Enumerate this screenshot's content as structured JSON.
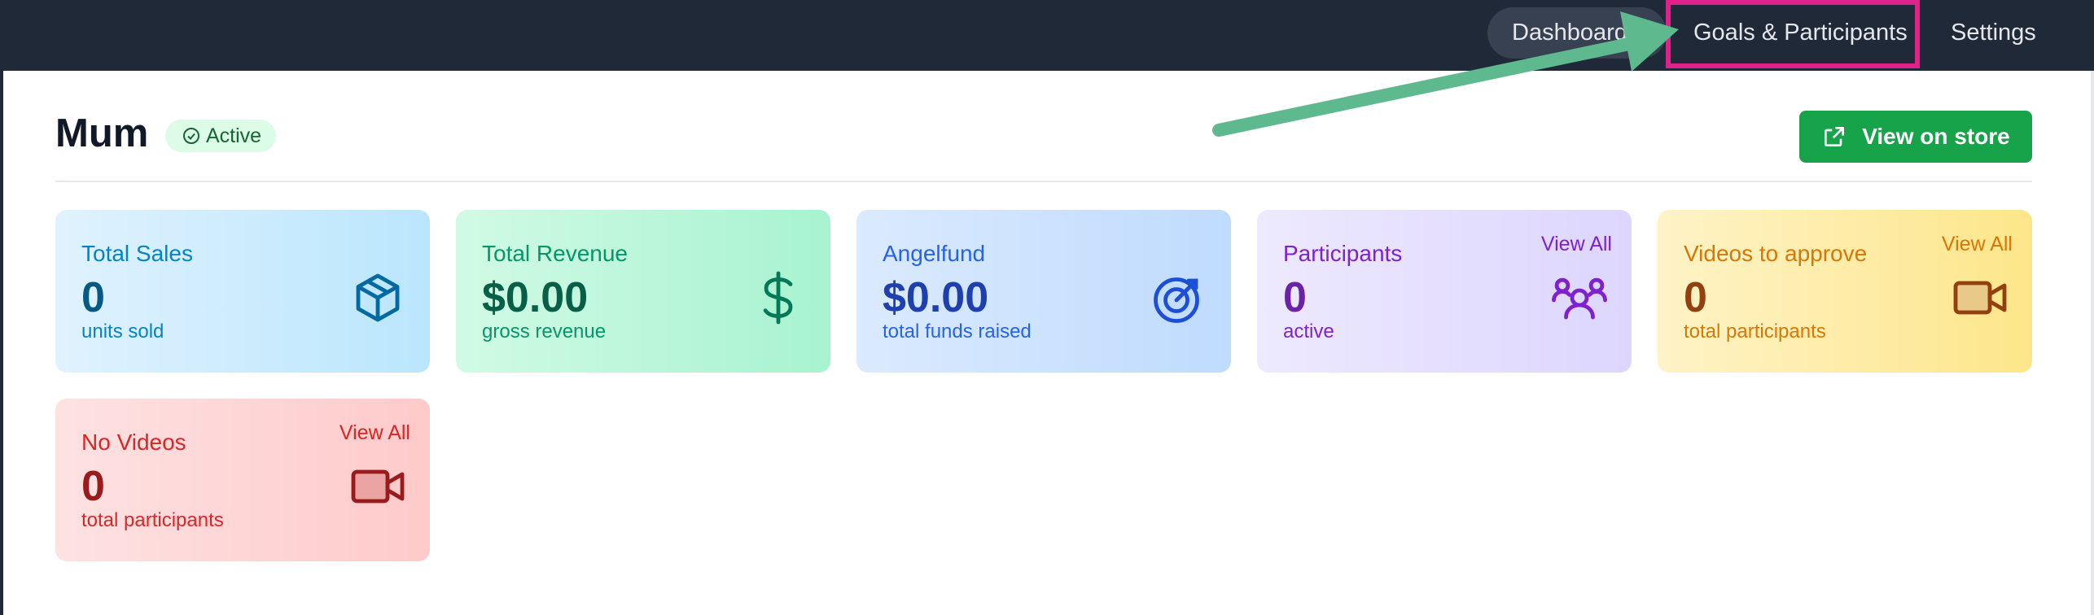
{
  "nav": {
    "dashboard_label": "Dashboard",
    "goals_label": "Goals & Participants",
    "settings_label": "Settings"
  },
  "header": {
    "title": "Mum",
    "status": "Active",
    "store_button": "View on store"
  },
  "cards": {
    "sales": {
      "title": "Total Sales",
      "value": "0",
      "subtitle": "units sold",
      "icon": "cube-icon"
    },
    "revenue": {
      "title": "Total Revenue",
      "value": "$0.00",
      "subtitle": "gross revenue",
      "icon": "dollar-icon"
    },
    "angelfund": {
      "title": "Angelfund",
      "value": "$0.00",
      "subtitle": "total funds raised",
      "icon": "target-icon"
    },
    "participants": {
      "title": "Participants",
      "value": "0",
      "subtitle": "active",
      "link": "View All",
      "icon": "users-icon"
    },
    "videos_to_approve": {
      "title": "Videos to approve",
      "value": "0",
      "subtitle": "total participants",
      "link": "View All",
      "icon": "video-camera-icon"
    },
    "no_videos": {
      "title": "No Videos",
      "value": "0",
      "subtitle": "total participants",
      "link": "View All",
      "icon": "video-camera-icon"
    }
  },
  "colors": {
    "nav_bg": "#1f2937",
    "accent_green": "#16a34a",
    "highlight": "#e0218a",
    "arrow": "#5fb98f"
  }
}
